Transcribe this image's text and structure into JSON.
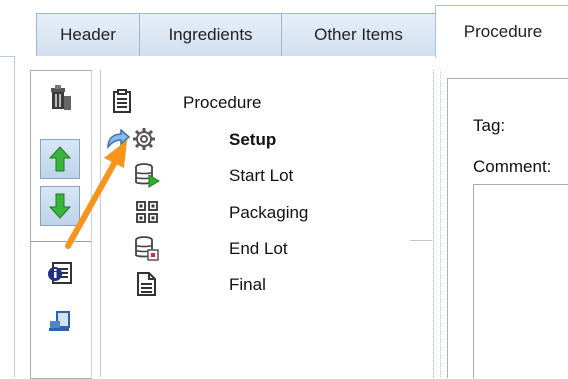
{
  "tabs": [
    {
      "label": "Header",
      "active": false
    },
    {
      "label": "Ingredients",
      "active": false
    },
    {
      "label": "Other Items",
      "active": false
    },
    {
      "label": "Procedure",
      "active": true
    }
  ],
  "tree": {
    "root": {
      "label": "Procedure",
      "icon": "clipboard-icon"
    },
    "items": [
      {
        "label": "Setup",
        "icon": "gear-icon",
        "bold": true,
        "current": true
      },
      {
        "label": "Start Lot",
        "icon": "database-play-icon"
      },
      {
        "label": "Packaging",
        "icon": "grid-icon"
      },
      {
        "label": "End Lot",
        "icon": "database-stop-icon"
      },
      {
        "label": "Final",
        "icon": "document-icon"
      }
    ]
  },
  "toolbar": {
    "icons": [
      "trash-icon",
      "move-up-icon",
      "move-down-icon",
      "info-card-icon",
      "export-icon"
    ]
  },
  "details": {
    "tag_label": "Tag:",
    "comment_label": "Comment:"
  },
  "colors": {
    "tab_bg": "#d2dfef",
    "annotation_arrow": "#f7941d",
    "up_arrow": "#3bb43b",
    "current_arrow": "#4a86c8"
  }
}
